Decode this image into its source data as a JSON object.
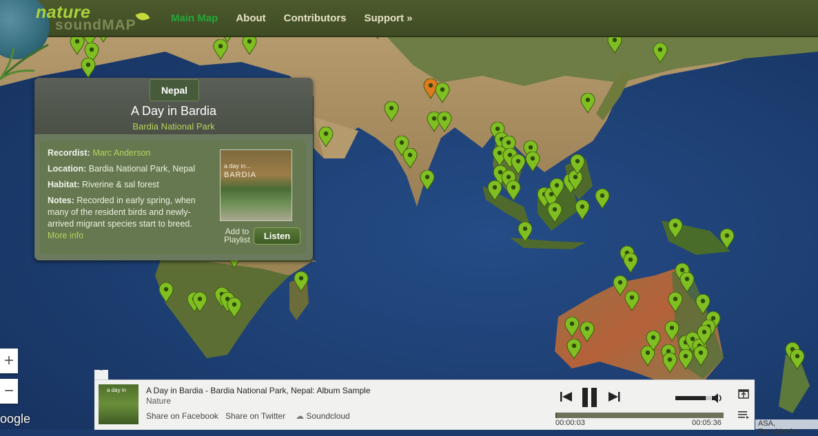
{
  "header": {
    "logo_word1": "nature",
    "logo_word2": "soundMAP",
    "nav": [
      {
        "label": "Main Map",
        "active": true
      },
      {
        "label": "About",
        "active": false
      },
      {
        "label": "Contributors",
        "active": false
      },
      {
        "label": "Support »",
        "active": false
      }
    ]
  },
  "info_panel": {
    "country": "Nepal",
    "title": "A Day in Bardia",
    "location_name": "Bardia National Park",
    "recordist_label": "Recordist:",
    "recordist": "Marc Anderson",
    "location_label": "Location:",
    "location": "Bardia National Park, Nepal",
    "habitat_label": "Habitat:",
    "habitat": "Riverine & sal forest",
    "notes_label": "Notes:",
    "notes": "Recorded in early spring, when many of the resident birds and newly-arrived migrant species start to breed.",
    "more_info": "More info",
    "cover_text1": "a day in...",
    "cover_text2": "BARDIA",
    "add_to_playlist": "Add to Playlist",
    "listen_button": "Listen"
  },
  "map": {
    "zoom_in": "+",
    "zoom_out": "−",
    "google": "oogle",
    "attribution": "ASA, TerraMetrics",
    "pin_color": "#7fbf22",
    "active_pin_color": "#e07a1c"
  },
  "player": {
    "collapse": "ˆ",
    "thumb_text": "a day in",
    "track_title": "A Day in Bardia - Bardia National Park, Nepal: Album Sample",
    "track_artist": "Nature",
    "share_facebook": "Share on Facebook",
    "share_twitter": "Share on Twitter",
    "soundcloud": "Soundcloud",
    "time_current": "00:00:03",
    "time_total": "00:05:36",
    "progress_fraction": 0.01,
    "volume_fraction": 0.85
  }
}
